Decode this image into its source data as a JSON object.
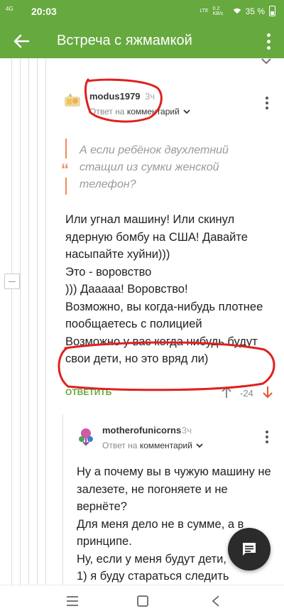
{
  "status_bar": {
    "network": "4G",
    "time": "20:03",
    "lte": "LTE",
    "speed": "0.2 KB/s",
    "battery": "35 %"
  },
  "app_bar": {
    "title": "Встреча с яжмамкой"
  },
  "colors": {
    "accent": "#66a93e",
    "quote": "#f28a5a",
    "annotation": "#e02020"
  },
  "comment_main": {
    "author": "modus1979",
    "time": "3ч",
    "reply_prefix": "Ответ на",
    "reply_target": "комментарий",
    "quote": "А если ребёнок двухлетний стащил из сумки женской телефон?",
    "body_lines": [
      "Или угнал машину! Или скинул ядерную бомбу на США! Давайте насыпайте хуйни)))",
      "Это - воровство",
      "))) Дааааа! Воровство!",
      "Возможно, вы когда-нибудь плотнее пообщаетесь с полицией",
      "Возможно у вас когда нибудь будут свои дети, но это вряд ли)"
    ],
    "reply_button": "ОТВЕТИТЬ",
    "rating": "-24"
  },
  "comment_reply": {
    "author": "motherofunicorns",
    "time": "3ч",
    "reply_prefix": "Ответ на",
    "reply_target": "комментарий",
    "body_lines": [
      "Ну а почему вы в чужую машину не залезете, не погоняете и не вернёте?",
      "Для меня дело не в сумме, а в принципе.",
      "Ну, если у меня будут дети,",
      "1) я буду стараться следить"
    ]
  },
  "icons": {
    "back": "arrow-back-icon",
    "menu": "more-vert-icon",
    "fab": "comment-icon",
    "nav_menu": "menu-icon",
    "nav_home": "home-icon",
    "nav_back": "back-icon"
  }
}
